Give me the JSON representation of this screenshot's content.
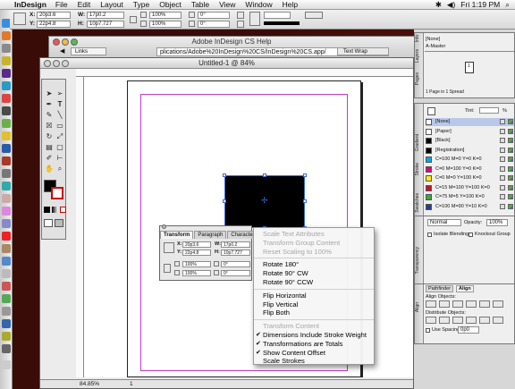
{
  "menubar": {
    "app_name": "InDesign",
    "menus": [
      "File",
      "Edit",
      "Layout",
      "Type",
      "Object",
      "Table",
      "View",
      "Window",
      "Help"
    ],
    "clock": "Fri 1:19 PM"
  },
  "control": {
    "x_label": "X:",
    "x_value": "20p3.6",
    "y_label": "Y:",
    "y_value": "22p4.8",
    "w_label": "W:",
    "w_value": "17p0.2",
    "h_label": "H:",
    "h_value": "10p7.727",
    "scale_x": "100%",
    "scale_y": "100%",
    "rotate": "0°",
    "shear": "0°"
  },
  "help_window": {
    "title": "Adobe InDesign CS Help",
    "address": "plications/Adobe%20InDesign%20CS/InDesign%20CS.app/",
    "tab_links": "Links",
    "tab_textwrap": "Text Wrap"
  },
  "document": {
    "title": "Untitled-1 @ 84%",
    "zoom": "84.85%",
    "page_number": "1"
  },
  "transform_palette": {
    "tabs": [
      "Transform",
      "Paragraph",
      "Character"
    ],
    "x_label": "X:",
    "x_value": "20p3.6",
    "y_label": "Y:",
    "y_value": "22p4.8",
    "w_label": "W:",
    "w_value": "17p0.2",
    "h_label": "H:",
    "h_value": "10p7.727",
    "scale_x": "100%",
    "scale_y": "100%",
    "rotate": "0°",
    "shear": "0°"
  },
  "context_menu": {
    "items": [
      {
        "label": "Scale Text Attributes",
        "disabled": true,
        "checked": false
      },
      {
        "label": "Transform Group Content",
        "disabled": true,
        "checked": false
      },
      {
        "label": "Reset Scaling to 100%",
        "disabled": true,
        "checked": false
      },
      {
        "sep": true
      },
      {
        "label": "Rotate 180°",
        "disabled": false,
        "checked": false
      },
      {
        "label": "Rotate 90° CW",
        "disabled": false,
        "checked": false
      },
      {
        "label": "Rotate 90° CCW",
        "disabled": false,
        "checked": false
      },
      {
        "sep": true
      },
      {
        "label": "Flip Horizontal",
        "disabled": false,
        "checked": false
      },
      {
        "label": "Flip Vertical",
        "disabled": false,
        "checked": false
      },
      {
        "label": "Flip Both",
        "disabled": false,
        "checked": false
      },
      {
        "sep": true
      },
      {
        "label": "Transform Content",
        "disabled": true,
        "checked": false
      },
      {
        "label": "Dimensions Include Stroke Weight",
        "disabled": false,
        "checked": true
      },
      {
        "label": "Transformations are Totals",
        "disabled": false,
        "checked": true
      },
      {
        "label": "Show Content Offset",
        "disabled": false,
        "checked": true
      },
      {
        "label": "Scale Strokes",
        "disabled": false,
        "checked": false
      }
    ]
  },
  "pages_panel": {
    "none_label": "[None]",
    "master_label": "A-Master",
    "page_label": "1",
    "status": "1 Page in 1 Spread"
  },
  "swatches_panel": {
    "tint_label": "Tint:",
    "tint_unit": "%",
    "swatches": [
      {
        "name": "[None]",
        "color": "#ffffff"
      },
      {
        "name": "[Paper]",
        "color": "#ffffff"
      },
      {
        "name": "[Black]",
        "color": "#000000"
      },
      {
        "name": "[Registration]",
        "color": "#000000"
      },
      {
        "name": "C=100 M=0 Y=0 K=0",
        "color": "#00a8e8"
      },
      {
        "name": "C=0 M=100 Y=0 K=0",
        "color": "#e2007a"
      },
      {
        "name": "C=0 M=0 Y=100 K=0",
        "color": "#ffec00"
      },
      {
        "name": "C=15 M=100 Y=100 K=0",
        "color": "#c8102e"
      },
      {
        "name": "C=75 M=5 Y=100 K=0",
        "color": "#3aa935"
      },
      {
        "name": "C=100 M=90 Y=10 K=0",
        "color": "#2a3a8f"
      }
    ]
  },
  "transparency_panel": {
    "mode": "Normal",
    "opacity_label": "Opacity:",
    "opacity_value": "100%",
    "isolate_label": "Isolate Blending",
    "knockout_label": "Knockout Group"
  },
  "align_panel": {
    "tab_pathfinder": "Pathfinder",
    "tab_align": "Align",
    "align_objects_label": "Align Objects:",
    "distribute_label": "Distribute Objects:",
    "use_spacing_label": "Use Spacing",
    "spacing_value": "0p0"
  },
  "side_tabs": {
    "pages": "Pages",
    "layers": "Layers",
    "info": "Info",
    "swatches": "Swatches",
    "stroke": "Stroke",
    "gradient": "Gradient",
    "transparency": "Transparency",
    "align": "Align"
  }
}
